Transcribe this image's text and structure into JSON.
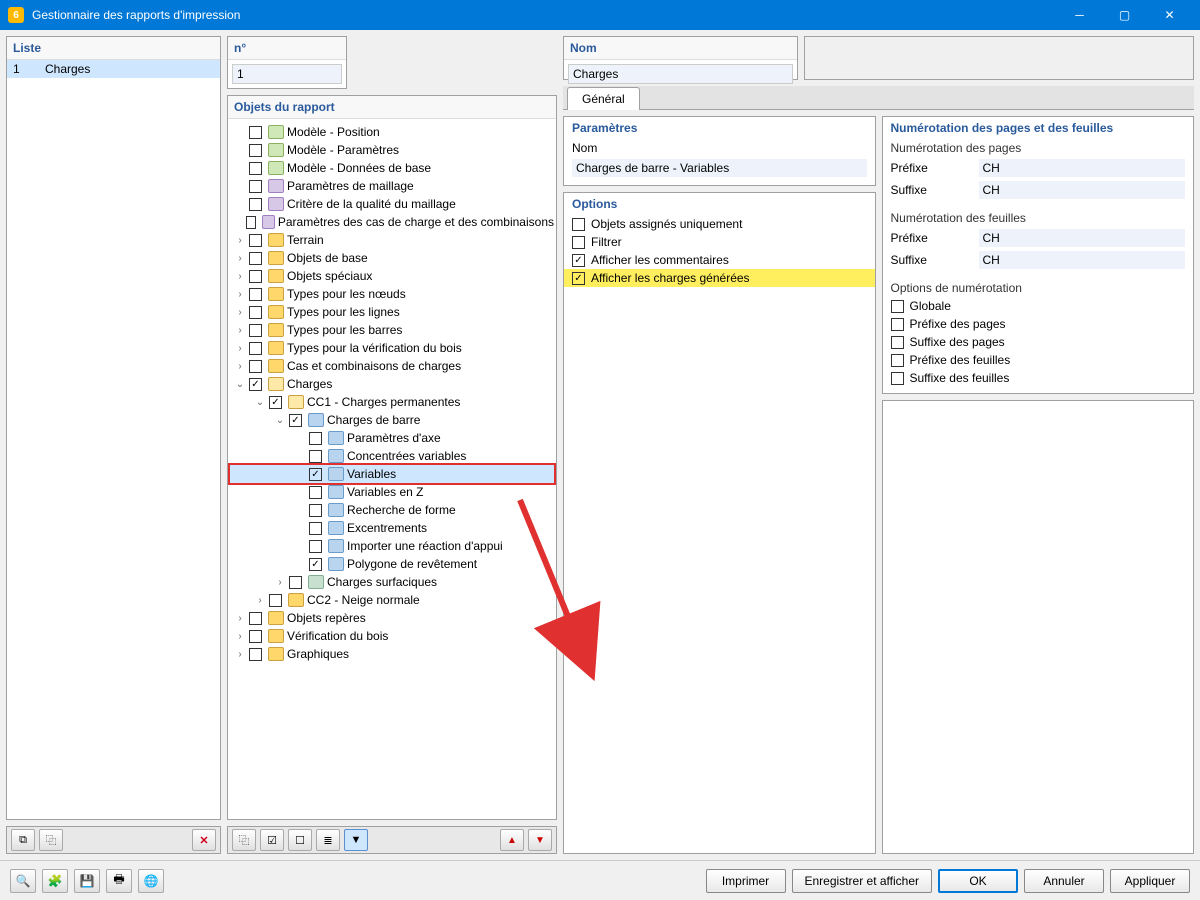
{
  "titlebar": {
    "app_badge": "6",
    "title": "Gestionnaire des rapports d'impression"
  },
  "left": {
    "header": "Liste",
    "rows": [
      {
        "num": "1",
        "name": "Charges"
      }
    ],
    "tools": {
      "new": "⧉",
      "dup": "⿻",
      "del": "✕"
    }
  },
  "mid": {
    "num_label": "n°",
    "num_value": "1",
    "nom_label": "Nom",
    "nom_value": "Charges",
    "tree_header": "Objets du rapport",
    "tree": [
      {
        "d": 0,
        "tw": "",
        "ck": false,
        "ic": "ic-model",
        "t": "Modèle - Position"
      },
      {
        "d": 0,
        "tw": "",
        "ck": false,
        "ic": "ic-model",
        "t": "Modèle - Paramètres"
      },
      {
        "d": 0,
        "tw": "",
        "ck": false,
        "ic": "ic-model",
        "t": "Modèle - Données de base"
      },
      {
        "d": 0,
        "tw": "",
        "ck": false,
        "ic": "ic-grid",
        "t": "Paramètres de maillage"
      },
      {
        "d": 0,
        "tw": "",
        "ck": false,
        "ic": "ic-grid",
        "t": "Critère de la qualité du maillage"
      },
      {
        "d": 0,
        "tw": "",
        "ck": false,
        "ic": "ic-grid",
        "t": "Paramètres des cas de charge et des combinaisons"
      },
      {
        "d": 0,
        "tw": "›",
        "ck": false,
        "ic": "ic-folder",
        "t": "Terrain"
      },
      {
        "d": 0,
        "tw": "›",
        "ck": false,
        "ic": "ic-folder",
        "t": "Objets de base"
      },
      {
        "d": 0,
        "tw": "›",
        "ck": false,
        "ic": "ic-folder",
        "t": "Objets spéciaux"
      },
      {
        "d": 0,
        "tw": "›",
        "ck": false,
        "ic": "ic-folder",
        "t": "Types pour les nœuds"
      },
      {
        "d": 0,
        "tw": "›",
        "ck": false,
        "ic": "ic-folder",
        "t": "Types pour les lignes"
      },
      {
        "d": 0,
        "tw": "›",
        "ck": false,
        "ic": "ic-folder",
        "t": "Types pour les barres"
      },
      {
        "d": 0,
        "tw": "›",
        "ck": false,
        "ic": "ic-folder",
        "t": "Types pour la vérification du bois"
      },
      {
        "d": 0,
        "tw": "›",
        "ck": false,
        "ic": "ic-folder",
        "t": "Cas et combinaisons de charges"
      },
      {
        "d": 0,
        "tw": "⌄",
        "ck": true,
        "ic": "ic-folder-o",
        "t": "Charges"
      },
      {
        "d": 1,
        "tw": "⌄",
        "ck": true,
        "ic": "ic-folder-o",
        "t": "CC1 - Charges permanentes"
      },
      {
        "d": 2,
        "tw": "⌄",
        "ck": true,
        "ic": "ic-item",
        "t": "Charges de barre"
      },
      {
        "d": 3,
        "tw": "",
        "ck": false,
        "ic": "ic-item",
        "t": "Paramètres d'axe"
      },
      {
        "d": 3,
        "tw": "",
        "ck": false,
        "ic": "ic-item",
        "t": "Concentrées variables"
      },
      {
        "d": 3,
        "tw": "",
        "ck": true,
        "ic": "ic-item",
        "t": "Variables",
        "sel": true,
        "boxed": true
      },
      {
        "d": 3,
        "tw": "",
        "ck": false,
        "ic": "ic-item",
        "t": "Variables en Z"
      },
      {
        "d": 3,
        "tw": "",
        "ck": false,
        "ic": "ic-item",
        "t": "Recherche de forme"
      },
      {
        "d": 3,
        "tw": "",
        "ck": false,
        "ic": "ic-item",
        "t": "Excentrements"
      },
      {
        "d": 3,
        "tw": "",
        "ck": false,
        "ic": "ic-item",
        "t": "Importer une réaction d'appui"
      },
      {
        "d": 3,
        "tw": "",
        "ck": true,
        "ic": "ic-item",
        "t": "Polygone de revêtement"
      },
      {
        "d": 2,
        "tw": "›",
        "ck": false,
        "ic": "ic-surf",
        "t": "Charges surfaciques"
      },
      {
        "d": 1,
        "tw": "›",
        "ck": false,
        "ic": "ic-folder",
        "t": "CC2 - Neige normale"
      },
      {
        "d": 0,
        "tw": "›",
        "ck": false,
        "ic": "ic-folder",
        "t": "Objets repères"
      },
      {
        "d": 0,
        "tw": "›",
        "ck": false,
        "ic": "ic-folder",
        "t": "Vérification du bois"
      },
      {
        "d": 0,
        "tw": "›",
        "ck": false,
        "ic": "ic-folder",
        "t": "Graphiques"
      }
    ],
    "tools": {
      "a": "⿻",
      "b": "☑",
      "c": "☐",
      "d": "≣",
      "e": "▼",
      "up": "▲",
      "dn": "▼"
    }
  },
  "right": {
    "tab_general": "Général",
    "param": {
      "header": "Paramètres",
      "name_label": "Nom",
      "name_value": "Charges de barre - Variables"
    },
    "numbering": {
      "header": "Numérotation des pages et des feuilles",
      "pages_sub": "Numérotation des pages",
      "prefix": "Préfixe",
      "suffix": "Suffixe",
      "pages_prefix": "CH",
      "pages_suffix": "CH",
      "sheets_sub": "Numérotation des feuilles",
      "sheets_prefix": "CH",
      "sheets_suffix": "CH",
      "opts_sub": "Options de numérotation",
      "opts": [
        {
          "ck": false,
          "t": "Globale"
        },
        {
          "ck": false,
          "t": "Préfixe des pages"
        },
        {
          "ck": false,
          "t": "Suffixe des pages"
        },
        {
          "ck": false,
          "t": "Préfixe des feuilles"
        },
        {
          "ck": false,
          "t": "Suffixe des feuilles"
        }
      ]
    },
    "options": {
      "header": "Options",
      "items": [
        {
          "ck": false,
          "hl": false,
          "t": "Objets assignés uniquement"
        },
        {
          "ck": false,
          "hl": false,
          "t": "Filtrer"
        },
        {
          "ck": true,
          "hl": false,
          "t": "Afficher les commentaires"
        },
        {
          "ck": true,
          "hl": true,
          "t": "Afficher les charges générées"
        }
      ]
    }
  },
  "footer": {
    "print": "Imprimer",
    "save_show": "Enregistrer et afficher",
    "ok": "OK",
    "cancel": "Annuler",
    "apply": "Appliquer"
  }
}
